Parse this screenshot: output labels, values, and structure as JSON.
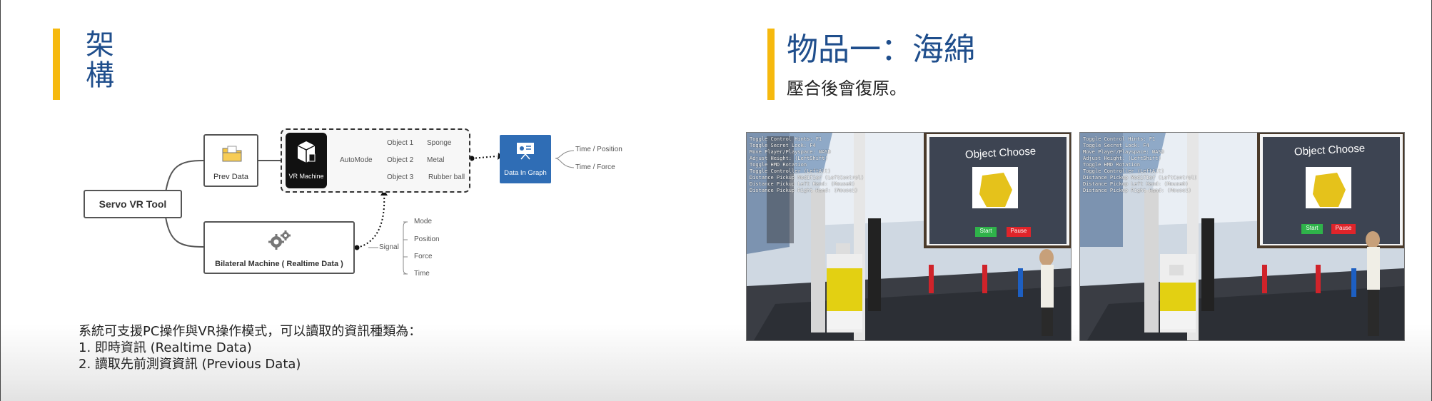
{
  "left": {
    "title": "架構",
    "diagram": {
      "root": "Servo VR Tool",
      "prev_data": "Prev Data",
      "vr_machine": "VR Machine",
      "automode": "AutoMode",
      "objects": [
        {
          "name": "Object 1",
          "material": "Sponge"
        },
        {
          "name": "Object 2",
          "material": "Metal"
        },
        {
          "name": "Object 3",
          "material": "Rubber ball"
        }
      ],
      "graph": "Data In Graph",
      "graph_outputs": [
        "Time / Position",
        "Time / Force"
      ],
      "bilateral": "Bilateral Machine ( Realtime Data )",
      "signal": "Signal",
      "signals": [
        "Mode",
        "Position",
        "Force",
        "Time"
      ]
    },
    "description": {
      "intro": "系統可支援PC操作與VR操作模式，可以讀取的資訊種類為：",
      "items": [
        "1.   即時資訊  (Realtime Data)",
        "2.   讀取先前測資資訊  (Previous Data)"
      ]
    }
  },
  "right": {
    "title": "物品一：海綿",
    "subtitle": "壓合後會復原。",
    "screens": [
      {
        "panel_title": "Object Choose",
        "start": "Start",
        "pause": "Pause",
        "hud": [
          "Toggle Control Hints: F1",
          "Toggle Secret Lock: F4",
          "Move Player/Playspace: WASD",
          "Adjust Height: (LeftShift)",
          "Toggle HMD Rotation",
          "Toggle Controller (LeftAlt)",
          "Distance Pickup Modifier (LeftControl)",
          "Distance Pickup Left Hand: (Mouse0)",
          "Distance Pickup Right Hand: (Mouse1)"
        ]
      },
      {
        "panel_title": "Object Choose",
        "start": "Start",
        "pause": "Pause",
        "hud": [
          "Toggle Control Hints: F1",
          "Toggle Secret Lock: F4",
          "Move Player/Playspace: WASD",
          "Adjust Height: (LeftShift)",
          "Toggle HMD Rotation",
          "Toggle Controller (LeftAlt)",
          "Distance Pickup Modifier (LeftControl)",
          "Distance Pickup Left Hand: (Mouse0)",
          "Distance Pickup Right Hand: (Mouse1)"
        ]
      }
    ]
  },
  "colors": {
    "accent": "#f6b90e",
    "title": "#1f4e8c",
    "graph_box": "#2f6db5",
    "start": "#2fb34a",
    "pause": "#e0242a"
  }
}
